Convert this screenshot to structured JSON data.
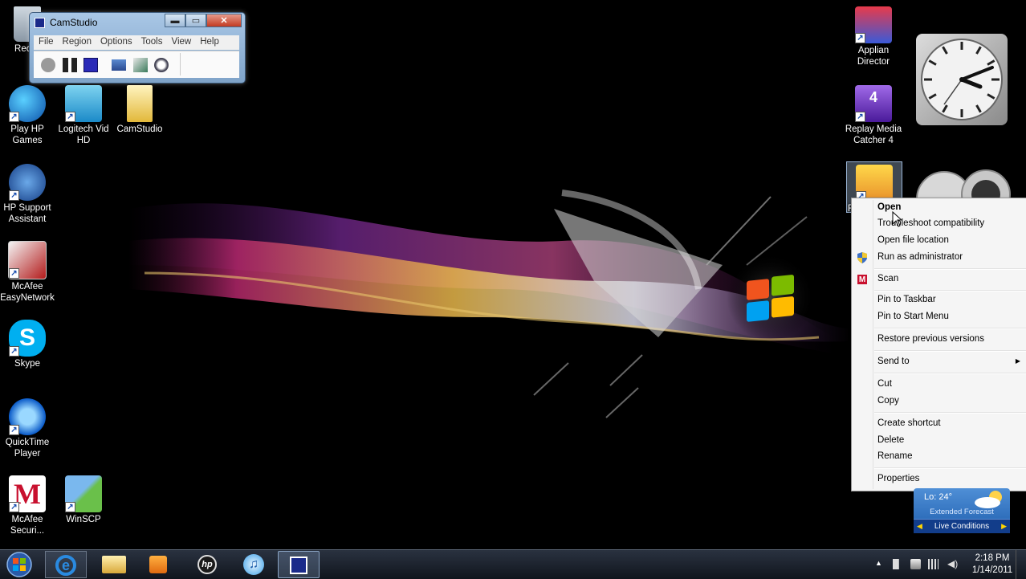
{
  "desktop_icons": [
    {
      "label": "Recyc",
      "icon": "recycle-bin-icon"
    },
    {
      "label": "Play HP Games",
      "icon": "hp-games-icon"
    },
    {
      "label": "Logitech Vid HD",
      "icon": "logitech-vid-icon"
    },
    {
      "label": "CamStudio",
      "icon": "folder-icon"
    },
    {
      "label": "HP Support Assistant",
      "icon": "hp-support-icon"
    },
    {
      "label": "McAfee EasyNetwork",
      "icon": "mcafee-easynetwork-icon"
    },
    {
      "label": "Skype",
      "icon": "skype-icon"
    },
    {
      "label": "QuickTime Player",
      "icon": "quicktime-icon"
    },
    {
      "label": "McAfee Securi...",
      "icon": "mcafee-security-icon"
    },
    {
      "label": "WinSCP",
      "icon": "winscp-icon"
    },
    {
      "label": "Applian Director",
      "icon": "applian-director-icon"
    },
    {
      "label": "Replay Media Catcher 4",
      "icon": "replay-media-catcher-icon"
    },
    {
      "label": "R",
      "icon": "selected-shortcut-icon"
    }
  ],
  "camstudio": {
    "title": "CamStudio",
    "controls": {
      "minimize": "▬",
      "maximize": "▭",
      "close": "✕"
    },
    "menu": [
      "File",
      "Region",
      "Options",
      "Tools",
      "View",
      "Help"
    ],
    "toolbar": [
      "record-icon",
      "pause-icon",
      "stop-icon",
      "region-icon",
      "annotate-icon",
      "swf-icon"
    ]
  },
  "context_menu": {
    "items": [
      {
        "label": "Open",
        "bold": true
      },
      {
        "label": "Troubleshoot compatibility"
      },
      {
        "label": "Open file location"
      },
      {
        "label": "Run as administrator",
        "icon": "uac-shield-icon"
      },
      {
        "label": "Scan",
        "icon": "mcafee-icon"
      },
      {
        "label": "Pin to Taskbar"
      },
      {
        "label": "Pin to Start Menu"
      },
      {
        "label": "Restore previous versions"
      },
      {
        "label": "Send to",
        "submenu": true
      },
      {
        "label": "Cut"
      },
      {
        "label": "Copy"
      },
      {
        "label": "Create shortcut"
      },
      {
        "label": "Delete"
      },
      {
        "label": "Rename"
      },
      {
        "label": "Properties"
      }
    ]
  },
  "weather": {
    "low": "Lo: 24°",
    "extended": "Extended Forecast",
    "live": "Live Conditions"
  },
  "taskbar": {
    "pinned": [
      "internet-explorer-icon",
      "windows-explorer-icon",
      "media-player-icon",
      "hp-icon",
      "itunes-icon",
      "camstudio-icon"
    ],
    "active_app": "camstudio-icon",
    "clock": {
      "time": "2:18 PM",
      "date": "1/14/2011"
    }
  },
  "colors": {
    "accent": "#1f5faf",
    "menu_bg": "#f5f5f5",
    "taskbar": "#1a2130"
  }
}
